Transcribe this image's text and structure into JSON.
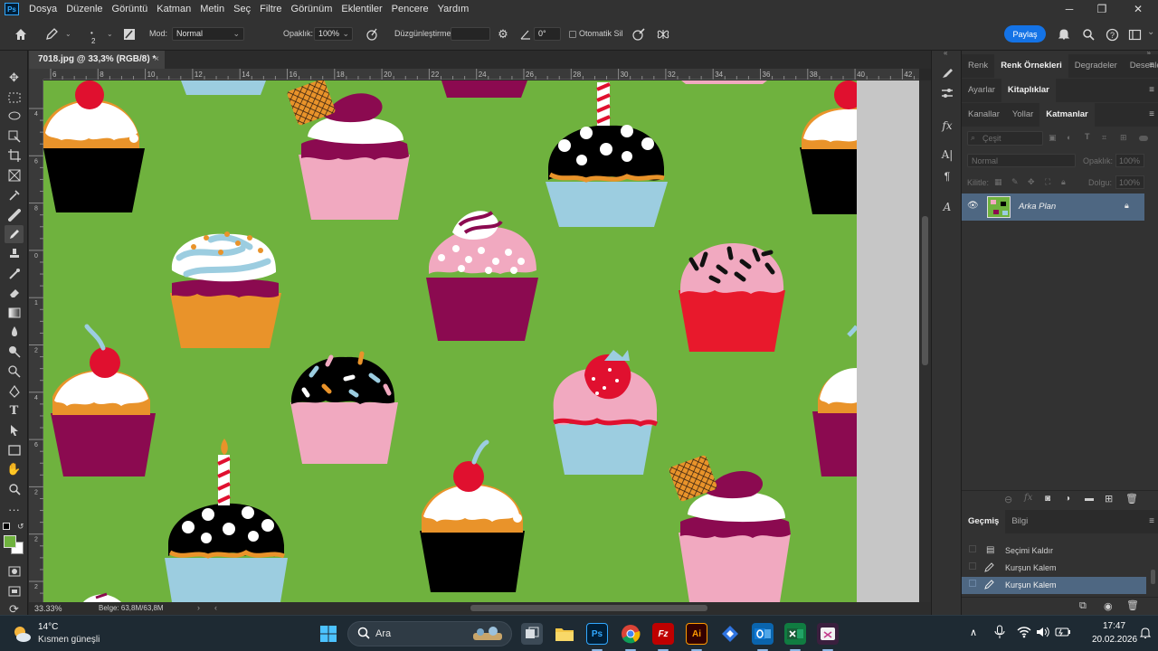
{
  "menu": {
    "app_logo": "Ps",
    "items": [
      "Dosya",
      "Düzenle",
      "Görüntü",
      "Katman",
      "Metin",
      "Seç",
      "Filtre",
      "Görünüm",
      "Eklentiler",
      "Pencere",
      "Yardım"
    ]
  },
  "options": {
    "brush_size": "2",
    "mode_label": "Mod:",
    "mode_value": "Normal",
    "opacity_label": "Opaklık:",
    "opacity_value": "100%",
    "smoothing_label": "Düzgünleştirme:",
    "smoothing_value": "",
    "angle_value": "0°",
    "auto_erase_label": "Otomatik Sil",
    "share_label": "Paylaş"
  },
  "document": {
    "tab_title": "7018.jpg @ 33,3% (RGB/8) *",
    "close_glyph": "×",
    "ruler_h": [
      "6",
      "8",
      "10",
      "12",
      "14",
      "16",
      "18",
      "20",
      "22",
      "24",
      "26",
      "28",
      "30",
      "32",
      "34",
      "36",
      "38",
      "40",
      "42"
    ],
    "ruler_v": [
      "4",
      "6",
      "8",
      "0",
      "1",
      "2",
      "4",
      "6",
      "2",
      "2",
      "2"
    ],
    "zoom": "33.33%",
    "doc_size": "Belge: 63,8M/63,8M"
  },
  "panels": {
    "row1_tabs": [
      "Renk",
      "Renk Örnekleri",
      "Degradeler",
      "Desenler"
    ],
    "row2_tabs": [
      "Ayarlar",
      "Kitaplıklar"
    ],
    "row3_tabs": [
      "Kanallar",
      "Yollar",
      "Katmanlar"
    ],
    "layers_filter_placeholder": "Çeşit",
    "blend_mode": "Normal",
    "opacity_label": "Opaklık:",
    "opacity_value": "100%",
    "lock_label": "Kilitle:",
    "fill_label": "Dolgu:",
    "fill_value": "100%",
    "layer_name": "Arka Plan",
    "history_tabs": [
      "Geçmiş",
      "Bilgi"
    ],
    "history_items": [
      "Seçimi Kaldır",
      "Kurşun Kalem",
      "Kurşun Kalem"
    ]
  },
  "taskbar": {
    "weather_temp": "14°C",
    "weather_desc": "Kısmen güneşli",
    "search_placeholder": "Ara",
    "time": "17:47",
    "date": "20.02.2026",
    "icons": [
      "windows-start",
      "search",
      "task-view",
      "file-explorer",
      "photoshop",
      "chrome",
      "filezilla",
      "illustrator",
      "extension",
      "outlook",
      "excel",
      "snipping-tool"
    ]
  },
  "colors": {
    "canvas_green": "#6fb23e",
    "accent_blue": "#1473e6",
    "panel_bg": "#323232",
    "selected_row": "#4e6782"
  }
}
